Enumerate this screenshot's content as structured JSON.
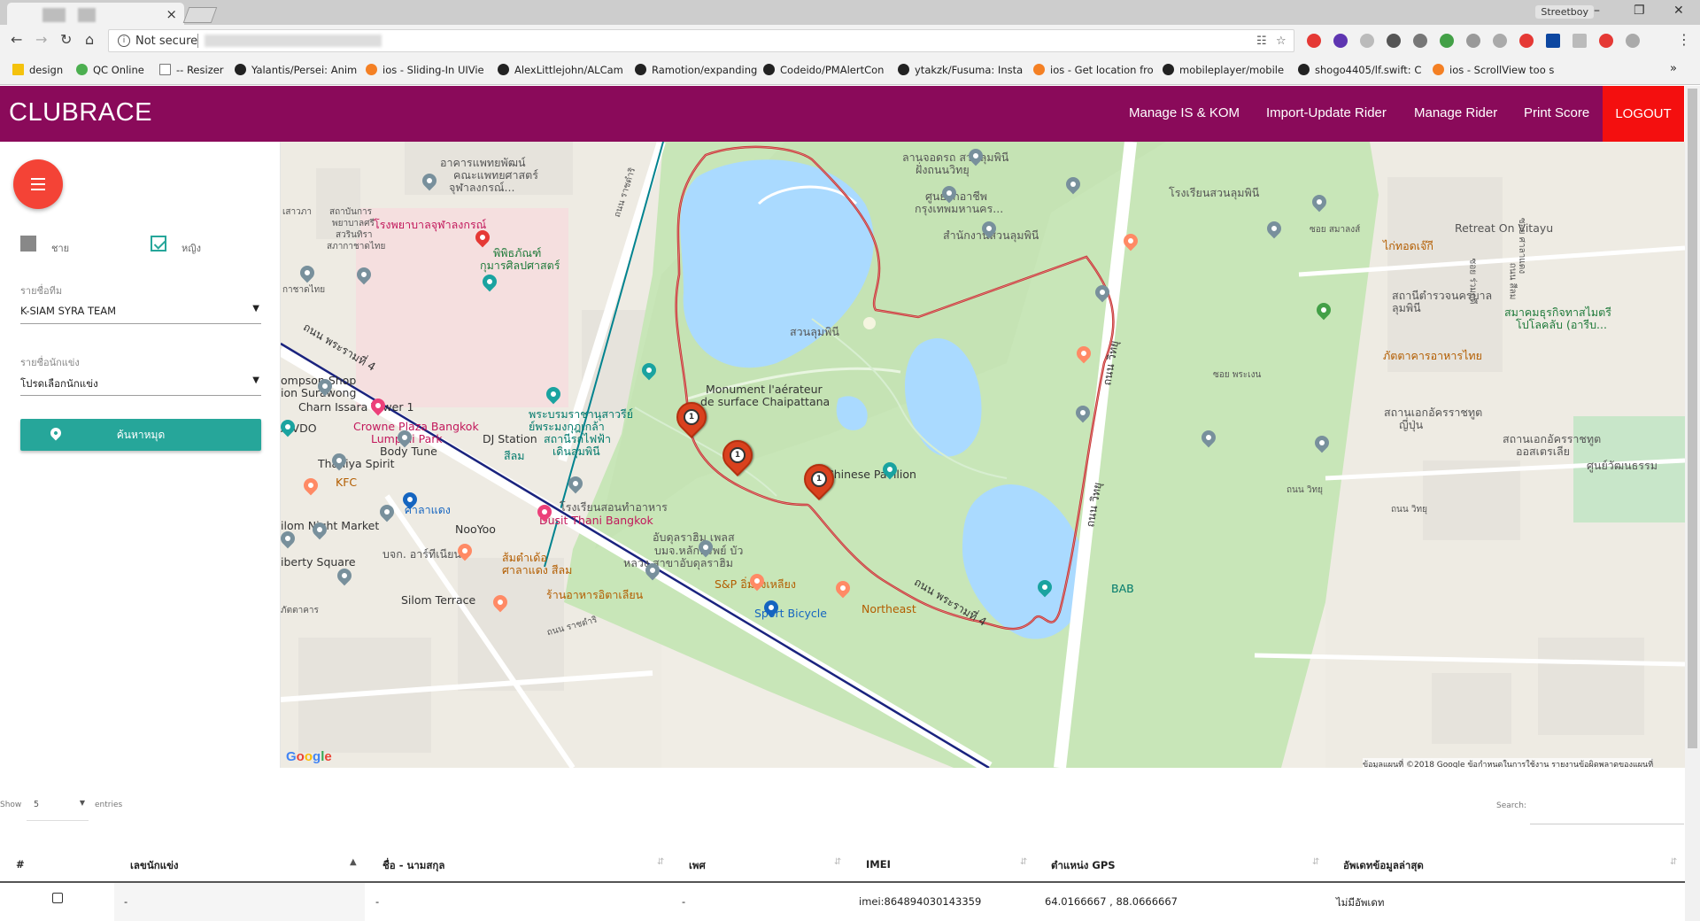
{
  "browser": {
    "tab_close": "×",
    "profile_name": "Streetboy",
    "omnibox": {
      "security_label": "Not secure"
    },
    "bookmarks": [
      {
        "label": "design",
        "color": "#f4c20d"
      },
      {
        "label": "QC Online",
        "color": "#4caf50"
      },
      {
        "label": "-- Resizer",
        "color": "#777777"
      },
      {
        "label": "Yalantis/Persei: Anim",
        "color": "#222222"
      },
      {
        "label": "ios - Sliding-In UIVie",
        "color": "#f48024"
      },
      {
        "label": "AlexLittlejohn/ALCam",
        "color": "#222222"
      },
      {
        "label": "Ramotion/expanding",
        "color": "#222222"
      },
      {
        "label": "Codeido/PMAlertCon",
        "color": "#222222"
      },
      {
        "label": "ytakzk/Fusuma: Insta",
        "color": "#222222"
      },
      {
        "label": "ios - Get location fro",
        "color": "#f48024"
      },
      {
        "label": "mobileplayer/mobile",
        "color": "#222222"
      },
      {
        "label": "shogo4405/lf.swift: C",
        "color": "#222222"
      },
      {
        "label": "ios - ScrollView too s",
        "color": "#f48024"
      }
    ],
    "bookmarks_more": "»"
  },
  "app": {
    "brand": "CLUBRACE",
    "nav": [
      "Manage IS & KOM",
      "Import-Update Rider",
      "Manage Rider",
      "Print Score"
    ],
    "logout": "LOGOUT",
    "colors": {
      "header": "#8a0a5a",
      "logout": "#f40f0f",
      "accent": "#26a69a",
      "fab": "#f44336"
    }
  },
  "sidebar": {
    "menu_icon": "hamburger-icon",
    "checkbox_male": {
      "label": "ชาย",
      "checked": false
    },
    "checkbox_female": {
      "label": "หญิง",
      "checked": true
    },
    "team": {
      "label": "รายชื่อทีม",
      "value": "K-SIAM SYRA TEAM"
    },
    "rider": {
      "label": "รายชื่อนักแข่ง",
      "value": "โปรดเลือกนักแข่ง"
    },
    "search_button": "ค้นหาหมุด"
  },
  "map": {
    "labels": {
      "l1": "อาคารแพทยพัฒน์",
      "l2": "คณะแพทยศาสตร์",
      "l3": "จุฬาลงกรณ์...",
      "l4": "สถาบันการ",
      "l5": "พยาบาลศรี",
      "l6": "สวรินทิรา",
      "l7": "สภากาชาดไทย",
      "l8": "เสาวภา",
      "l9": "โรงพยาบาลจุฬาลงกรณ์",
      "l10": "พิพิธภัณฑ์",
      "l11": "กุมารศิลปศาสตร์",
      "l12": "กาชาดไทย",
      "l13": "ถนน ราชดำริ",
      "l14": "ลานจอดรถ สวนลุมพินี",
      "l15": "ฝั่งถนนวิทยุ",
      "l16": "ศูนย์ฝึกอาชีพ",
      "l17": "กรุงเทพมหานคร...",
      "l18": "โรงเรียนสวนลุมพินี",
      "l19": "สำนักงานสวนลุมพินี",
      "l20": "Retreat On Vitayu",
      "l21": "ไก่ทอดเจ๊กี",
      "l22": "สถานีตำรวจนครบาล",
      "l23": "ลุมพินี",
      "l24": "สมาคมธุรกิจทาสไมตรี",
      "l25": "โปโลคลับ (อารีบ...",
      "l26": "ภัตตาคารอาหารไทย",
      "l27": "สวนลุมพินี",
      "l28": "ompson Shop",
      "l29": "ion Surawong",
      "l30": "Charn Issara Tower 1",
      "l31": "Monument l'aérateur",
      "l32": "de surface Chaipattana",
      "l33": "A VDO",
      "l34": "Crowne Plaza Bangkok",
      "l35": "Lumpini Park",
      "l36": "DJ Station",
      "l37": "Body Tune",
      "l38": "Thaniya Spirit",
      "l39": "พระบรมราชานุสาวรีย์",
      "l40": "ย์พระมงกุฎเกล้า",
      "l41": "สถานีรถไฟฟ้า",
      "l42": "เดินลุมพินี",
      "l43": "สีลม",
      "l44": "Chinese Pavilion",
      "l45": "สถานเอกอัครราชทูต",
      "l46": "ญี่ปุ่น",
      "l47": "สถานเอกอัครราชทูต",
      "l48": "ออสเตรเลีย",
      "l49": "ศูนย์วัฒนธรรม",
      "l50": "KFC",
      "l51": "ศาลาแดง",
      "l52": "NooYoo",
      "l53": "Dusit Thani Bangkok",
      "l54": "โรงเรียนสอนทำอาหาร",
      "l55": "ilom Night Market",
      "l56": "iberty Square",
      "l57": "บจก. อาร์ทีเนียน",
      "l58": "อับดุลราฮิม เพลส",
      "l59": "บมจ.หลักทรัพย์ บัว",
      "l60": "หลวง สาขาอับดุลราฮิม",
      "l61": "ส้มตำเด้อ",
      "l62": "ศาลาแดง สีลม",
      "l63": "S&P อิ่มจังเหลียง",
      "l64": "Silom Terrace",
      "l65": "ร้านอาหารอิตาเลียน",
      "l66": "Sport Bicycle",
      "l67": "Northeast",
      "l68": "BAB",
      "l69": "ถนน พระรามที่ 4",
      "l70": "ถนน พระรามที่ 4",
      "l71": "ถนน วิทยุ",
      "l72": "ถนน วิทยุ",
      "l73": "ถนน วิทยุ",
      "l74": "ถนน วิทยุ",
      "l75": "ซอย พระเงน",
      "l76": "ซอย สมาลงส์",
      "l77": "ภัตตาคาร",
      "l78": "ถนน ราชดำริ",
      "l79": "ซอย ร่วมฤดี",
      "l80": "ซอย ศาลาแดง",
      "l81": "ถนน สีลม"
    },
    "route_marker_label": "1",
    "google_logo": [
      "G",
      "o",
      "o",
      "g",
      "l",
      "e"
    ],
    "attribution": "ข้อมูลแผนที่ ©2018 Google   ข้อกำหนดในการใช้งาน   รายงานข้อผิดพลาดของแผนที่"
  },
  "table": {
    "show_label": "Show",
    "page_length": "5",
    "entries_label": "entries",
    "search_label": "Search:",
    "columns": [
      "#",
      "เลขนักแข่ง",
      "ชื่อ - นามสกุล",
      "เพศ",
      "IMEI",
      "ตำแหน่ง GPS",
      "อัพเดทข้อมูลล่าสุด"
    ],
    "rows": [
      {
        "num": "-",
        "name": "-",
        "gender": "-",
        "imei": "imei:864894030143359",
        "gps": "64.0166667 , 88.0666667",
        "updated": "ไม่มีอัพเดท"
      }
    ]
  }
}
